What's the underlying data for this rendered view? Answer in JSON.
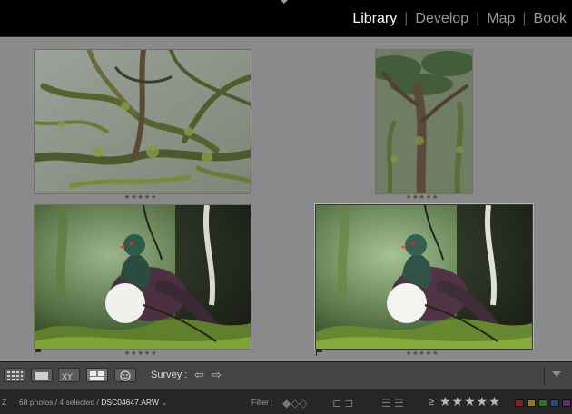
{
  "modules": {
    "items": [
      "Library",
      "Develop",
      "Map",
      "Book"
    ],
    "active": "Library"
  },
  "photos": [
    {
      "id": "photo-1",
      "subject": "mossy-branches",
      "rating_stars": "★★★★★",
      "flag": false
    },
    {
      "id": "photo-2",
      "subject": "fern-tree",
      "rating_stars": "★★★★★",
      "flag": false
    },
    {
      "id": "photo-3",
      "subject": "pigeon",
      "rating_stars": "★★★★★",
      "flag": true
    },
    {
      "id": "photo-4",
      "subject": "pigeon",
      "rating_stars": "★★★★★",
      "flag": true,
      "selected": true
    }
  ],
  "toolbar": {
    "mode_label": "Survey :",
    "prev_icon": "arrow-left-icon",
    "next_icon": "arrow-right-icon",
    "view_buttons": [
      "grid-view-icon",
      "loupe-view-icon",
      "compare-view-icon",
      "survey-view-icon",
      "people-view-icon"
    ]
  },
  "statusbar": {
    "zoom_marker": "Z",
    "photo_count": "68 photos / 4 selected /",
    "filename": "DSC04647.ARW",
    "filter_label": "Filter :",
    "rating_operator": "≥",
    "rating_stars": "★★★★★",
    "color_labels": [
      "#8a1c1c",
      "#8c7a16",
      "#2f6d2a",
      "#2a4d7a",
      "#5a2e6e"
    ]
  }
}
